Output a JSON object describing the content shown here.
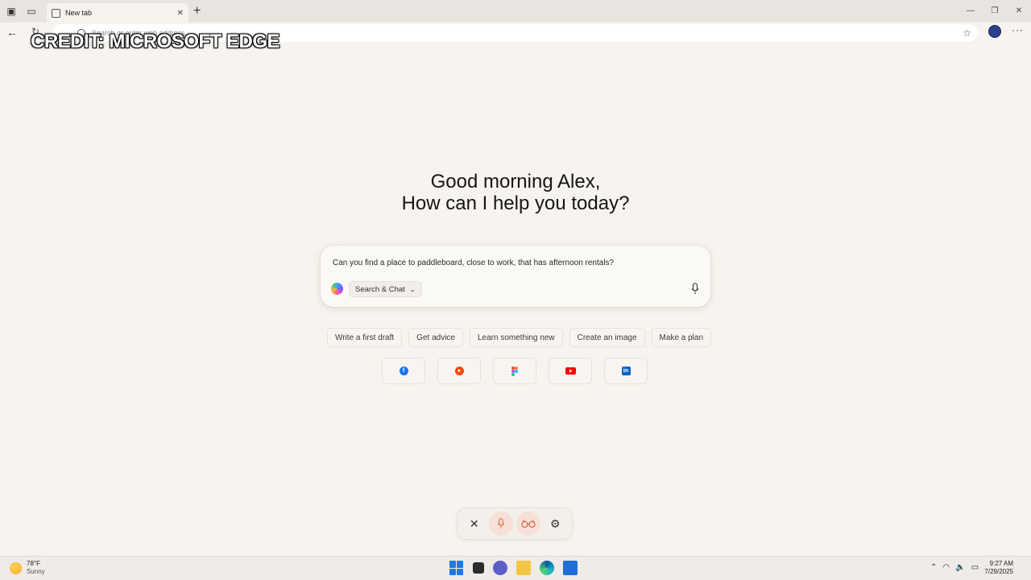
{
  "browser": {
    "tab_title": "New tab",
    "address_placeholder": "Search or enter web address"
  },
  "watermark": "CREDIT: MICROSOFT EDGE",
  "greeting": {
    "line1": "Good morning Alex,",
    "line2": "How can I help you today?"
  },
  "composer": {
    "prompt_text": "Can you find a place to paddleboard, close to work, that has afternoon rentals?",
    "mode_label": "Search & Chat"
  },
  "suggestions": [
    "Write a first draft",
    "Get advice",
    "Learn something new",
    "Create an image",
    "Make a plan"
  ],
  "site_tiles": [
    {
      "name": "facebook-icon",
      "color": "#1877f2"
    },
    {
      "name": "reddit-icon",
      "color": "#ff4500"
    },
    {
      "name": "figma-icon",
      "color": "#f24e1e"
    },
    {
      "name": "youtube-icon",
      "color": "#ff0000"
    },
    {
      "name": "linkedin-icon",
      "color": "#0a66c2"
    }
  ],
  "voice_toolbar": [
    "close-icon",
    "microphone-icon",
    "glasses-icon",
    "gear-icon"
  ],
  "taskbar": {
    "weather_temp": "78°F",
    "weather_condition": "Sunny",
    "time": "9:27 AM",
    "date": "7/29/2025"
  },
  "colors": {
    "background": "#f7f3ee",
    "accent": "#e0704a"
  }
}
